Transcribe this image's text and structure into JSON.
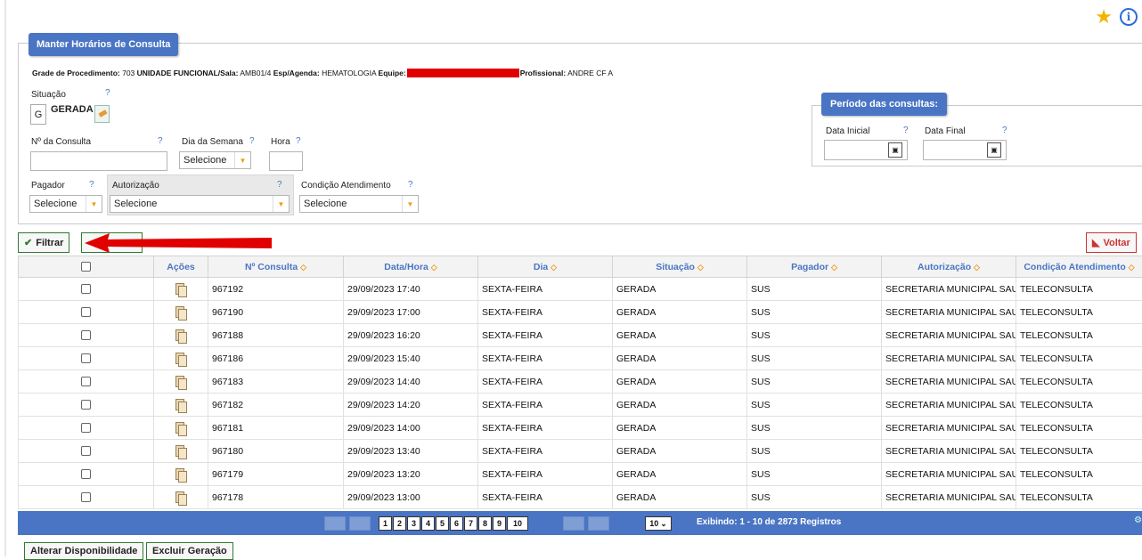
{
  "panel_title": "Manter Horários de Consulta",
  "grade": {
    "label1": "Grade de Procedimento:",
    "proc": "703",
    "label2": "UNIDADE FUNCIONAL",
    "label3": "/Sala:",
    "sala": "AMB01/4",
    "label4": "Esp/Agenda:",
    "agenda": "HEMATOLOGIA",
    "label5": "Equipe:",
    "label6": "Profissional:",
    "profissional": "ANDRE CF A"
  },
  "help": "?",
  "situacao": {
    "label": "Situação",
    "code": "G",
    "text": "GERADA"
  },
  "n_consulta": {
    "label": "Nº da Consulta",
    "value": ""
  },
  "dia_semana": {
    "label": "Dia da Semana",
    "value": "Selecione"
  },
  "hora": {
    "label": "Hora",
    "value": ""
  },
  "pagador": {
    "label": "Pagador",
    "value": "Selecione"
  },
  "autorizacao": {
    "label": "Autorização",
    "value": "Selecione"
  },
  "condicao": {
    "label": "Condição Atendimento",
    "value": "Selecione"
  },
  "periodo": {
    "title": "Período das consultas:",
    "data_inicial": "Data Inicial",
    "data_final": "Data Final",
    "cal_glyph": "▣"
  },
  "buttons": {
    "filtrar": "Filtrar",
    "voltar": "Voltar",
    "alterar": "Alterar Disponibilidade",
    "excluir": "Excluir Geração"
  },
  "table": {
    "headers": [
      "Ações",
      "Nº Consulta",
      "Data/Hora",
      "Dia",
      "Situação",
      "Pagador",
      "Autorização",
      "Condição Atendimento"
    ],
    "sort_glyph": "◇",
    "rows": [
      {
        "n": "967192",
        "dh": "29/09/2023 17:40",
        "dia": "SEXTA-FEIRA",
        "sit": "GERADA",
        "pag": "SUS",
        "aut": "SECRETARIA MUNICIPAL SAU",
        "cond": "TELECONSULTA"
      },
      {
        "n": "967190",
        "dh": "29/09/2023 17:00",
        "dia": "SEXTA-FEIRA",
        "sit": "GERADA",
        "pag": "SUS",
        "aut": "SECRETARIA MUNICIPAL SAU",
        "cond": "TELECONSULTA"
      },
      {
        "n": "967188",
        "dh": "29/09/2023 16:20",
        "dia": "SEXTA-FEIRA",
        "sit": "GERADA",
        "pag": "SUS",
        "aut": "SECRETARIA MUNICIPAL SAU",
        "cond": "TELECONSULTA"
      },
      {
        "n": "967186",
        "dh": "29/09/2023 15:40",
        "dia": "SEXTA-FEIRA",
        "sit": "GERADA",
        "pag": "SUS",
        "aut": "SECRETARIA MUNICIPAL SAU",
        "cond": "TELECONSULTA"
      },
      {
        "n": "967183",
        "dh": "29/09/2023 14:40",
        "dia": "SEXTA-FEIRA",
        "sit": "GERADA",
        "pag": "SUS",
        "aut": "SECRETARIA MUNICIPAL SAU",
        "cond": "TELECONSULTA"
      },
      {
        "n": "967182",
        "dh": "29/09/2023 14:20",
        "dia": "SEXTA-FEIRA",
        "sit": "GERADA",
        "pag": "SUS",
        "aut": "SECRETARIA MUNICIPAL SAU",
        "cond": "TELECONSULTA"
      },
      {
        "n": "967181",
        "dh": "29/09/2023 14:00",
        "dia": "SEXTA-FEIRA",
        "sit": "GERADA",
        "pag": "SUS",
        "aut": "SECRETARIA MUNICIPAL SAU",
        "cond": "TELECONSULTA"
      },
      {
        "n": "967180",
        "dh": "29/09/2023 13:40",
        "dia": "SEXTA-FEIRA",
        "sit": "GERADA",
        "pag": "SUS",
        "aut": "SECRETARIA MUNICIPAL SAU",
        "cond": "TELECONSULTA"
      },
      {
        "n": "967179",
        "dh": "29/09/2023 13:20",
        "dia": "SEXTA-FEIRA",
        "sit": "GERADA",
        "pag": "SUS",
        "aut": "SECRETARIA MUNICIPAL SAU",
        "cond": "TELECONSULTA"
      },
      {
        "n": "967178",
        "dh": "29/09/2023 13:00",
        "dia": "SEXTA-FEIRA",
        "sit": "GERADA",
        "pag": "SUS",
        "aut": "SECRETARIA MUNICIPAL SAU",
        "cond": "TELECONSULTA"
      }
    ]
  },
  "pager": {
    "pages": [
      "1",
      "2",
      "3",
      "4",
      "5",
      "6",
      "7",
      "8",
      "9",
      "10"
    ],
    "page_size": "10",
    "info": "Exibindo: 1 - 10 de 2873 Registros"
  },
  "colors": {
    "accent": "#4a75c4",
    "sort": "#f09a1a",
    "annotation": "#e10000"
  }
}
